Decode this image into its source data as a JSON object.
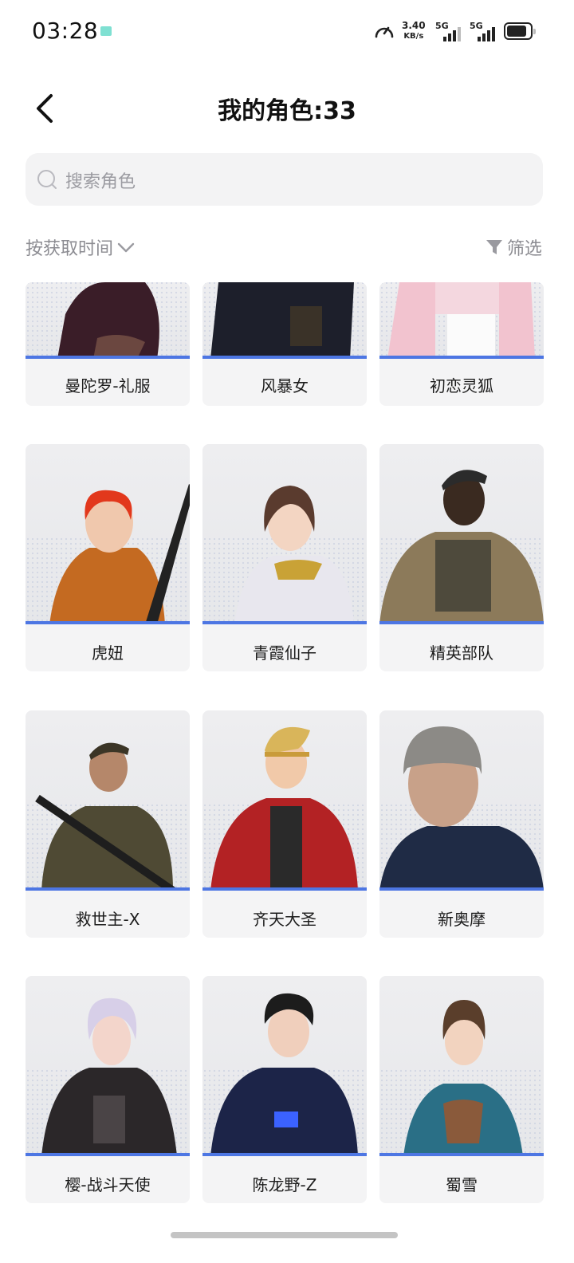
{
  "status": {
    "time": "03:28",
    "speed_value": "3.40",
    "speed_unit": "KB/s",
    "sig1_label": "5G",
    "sig2_label": "5G"
  },
  "header": {
    "title": "我的角色:33"
  },
  "search": {
    "placeholder": "搜索角色"
  },
  "toolbar": {
    "sort_label": "按获取时间",
    "filter_label": "筛选"
  },
  "characters": [
    {
      "name": "曼陀罗-礼服"
    },
    {
      "name": "风暴女"
    },
    {
      "name": "初恋灵狐"
    },
    {
      "name": "虎妞"
    },
    {
      "name": "青霞仙子"
    },
    {
      "name": "精英部队"
    },
    {
      "name": "救世主-X"
    },
    {
      "name": "齐天大圣"
    },
    {
      "name": "新奥摩"
    },
    {
      "name": "樱-战斗天使"
    },
    {
      "name": "陈龙野-Z"
    },
    {
      "name": "蜀雪"
    }
  ],
  "colors": {
    "accent_stripe": "#4d76e3",
    "card_bg": "#f4f4f5",
    "search_bg": "#f3f3f4",
    "muted_text": "#8c8c92"
  }
}
